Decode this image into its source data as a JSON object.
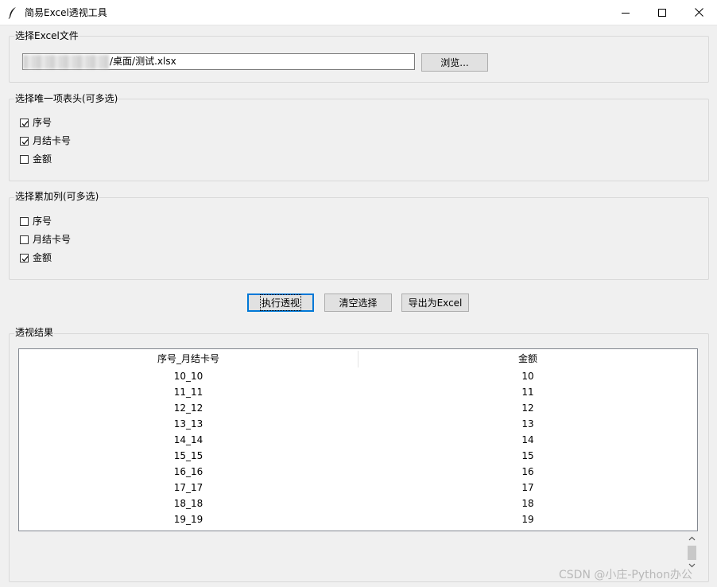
{
  "window": {
    "title": "简易Excel透视工具"
  },
  "file_section": {
    "label": "选择Excel文件",
    "path_value": "/桌面/测试.xlsx",
    "browse_label": "浏览..."
  },
  "header_section": {
    "label": "选择唯一项表头(可多选)",
    "items": [
      {
        "label": "序号",
        "checked": true
      },
      {
        "label": "月结卡号",
        "checked": true
      },
      {
        "label": "金额",
        "checked": false
      }
    ]
  },
  "sum_section": {
    "label": "选择累加列(可多选)",
    "items": [
      {
        "label": "序号",
        "checked": false
      },
      {
        "label": "月结卡号",
        "checked": false
      },
      {
        "label": "金额",
        "checked": true
      }
    ]
  },
  "actions": {
    "run_label": "执行透视",
    "clear_label": "清空选择",
    "export_label": "导出为Excel"
  },
  "result_section": {
    "label": "透视结果",
    "columns": [
      "序号_月结卡号",
      "金额"
    ],
    "rows": [
      [
        "10_10",
        "10"
      ],
      [
        "11_11",
        "11"
      ],
      [
        "12_12",
        "12"
      ],
      [
        "13_13",
        "13"
      ],
      [
        "14_14",
        "14"
      ],
      [
        "15_15",
        "15"
      ],
      [
        "16_16",
        "16"
      ],
      [
        "17_17",
        "17"
      ],
      [
        "18_18",
        "18"
      ],
      [
        "19_19",
        "19"
      ]
    ]
  },
  "watermark": "CSDN @小庄-Python办公"
}
